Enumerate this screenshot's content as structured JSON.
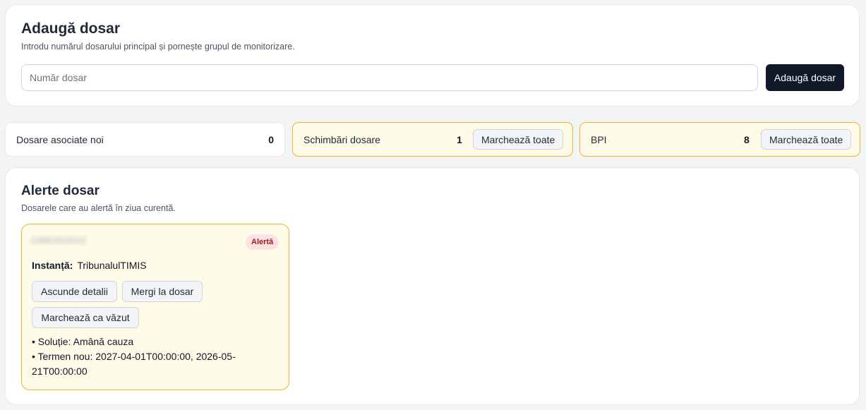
{
  "add_case": {
    "title": "Adaugă dosar",
    "subtitle": "Introdu numărul dosarului principal și pornește grupul de monitorizare.",
    "input_placeholder": "Număr dosar",
    "input_value": "",
    "button_label": "Adaugă dosar"
  },
  "stats": [
    {
      "label": "Dosare asociate noi",
      "count": "0"
    },
    {
      "label": "Schimbări dosare",
      "count": "1",
      "button_label": "Marchează toate"
    },
    {
      "label": "BPI",
      "count": "8",
      "button_label": "Marchează toate"
    }
  ],
  "alerts": {
    "title": "Alerte dosar",
    "subtitle": "Dosarele care au alertă în ziua curentă.",
    "items": [
      {
        "case_number": "2388/30/2023",
        "badge": "Alertă",
        "court_label": "Instanță:",
        "court_value": "TribunalulTIMIS",
        "hide_details_label": "Ascunde detalii",
        "go_to_case_label": "Mergi la dosar",
        "mark_seen_label": "Marchează ca văzut",
        "details": [
          "• Soluție: Amână cauza",
          "• Termen nou: 2027-04-01T00:00:00, 2026-05-21T00:00:00"
        ]
      }
    ]
  },
  "colors": {
    "primary_button": "#111827",
    "highlight_border": "#f0b429",
    "highlight_background": "#fefce8",
    "badge_background": "#fde2e4",
    "badge_text": "#991b1b"
  }
}
